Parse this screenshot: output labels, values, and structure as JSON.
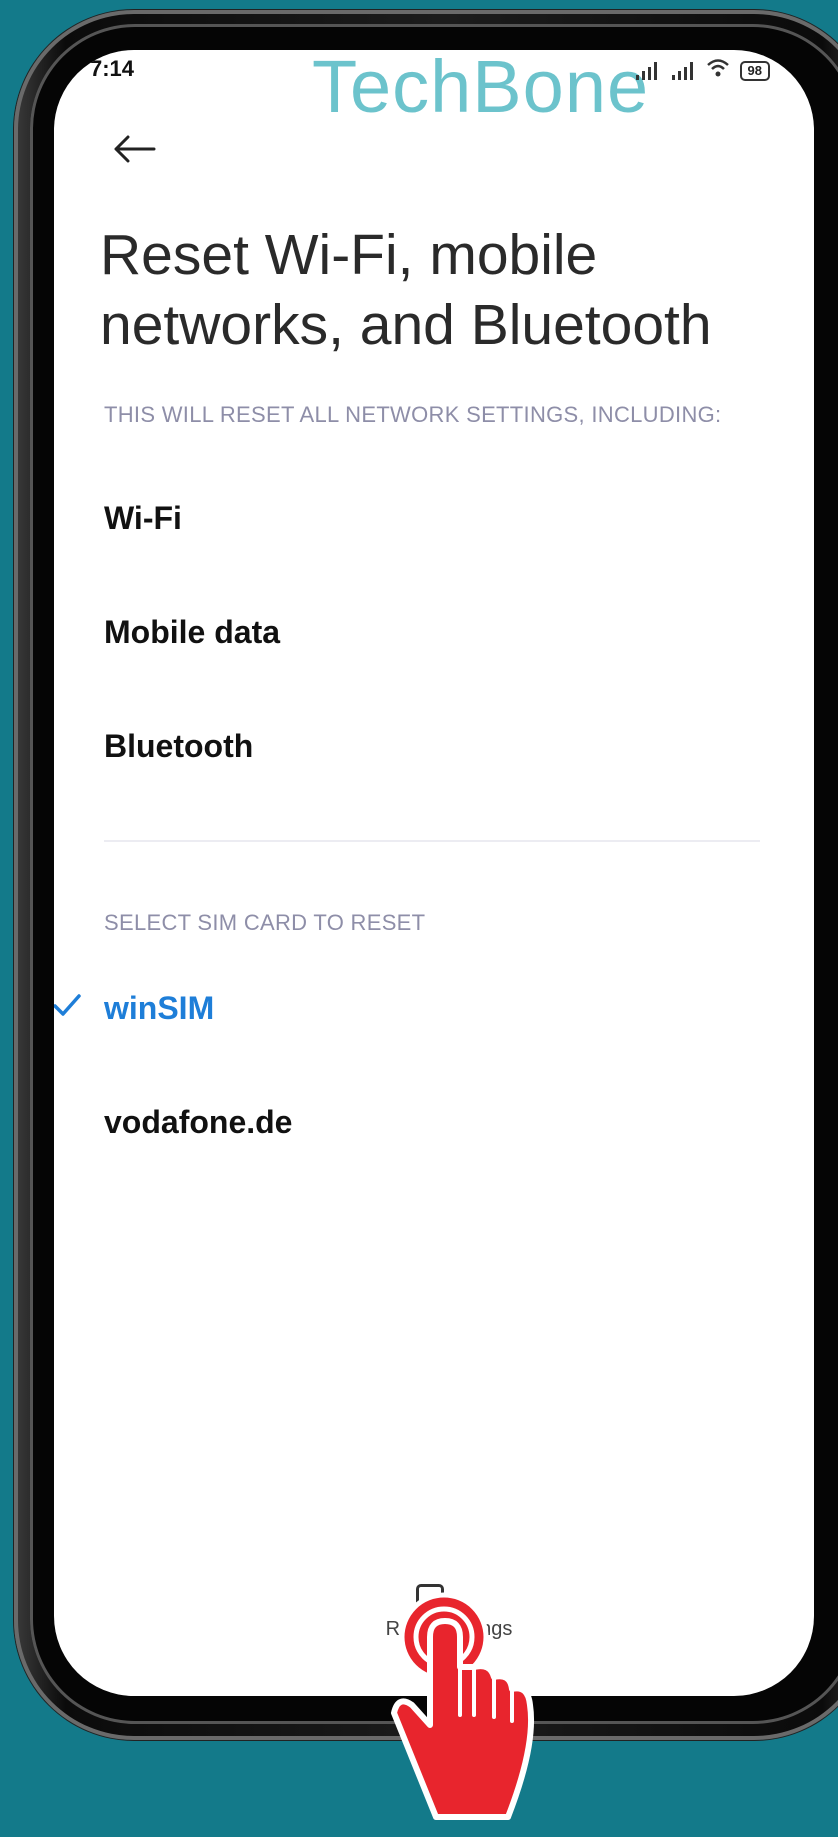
{
  "theme": {
    "background": "#137a8a",
    "accent": "#1e7ed8",
    "watermark": "#6cc3cc",
    "hand": "#e8252d"
  },
  "status_bar": {
    "time": "7:14",
    "battery": "98"
  },
  "watermark": {
    "text": "TechBone"
  },
  "header": {
    "back_icon": "arrow-left-icon"
  },
  "page": {
    "title_line1": "Reset Wi-Fi, mobile",
    "title_line2": "networks, and Bluetooth",
    "network_section_heading": "THIS WILL RESET ALL NETWORK SETTINGS, INCLUDING:",
    "network_items": [
      "Wi-Fi",
      "Mobile data",
      "Bluetooth"
    ],
    "sim_section_heading": "SELECT SIM CARD TO RESET",
    "sim_options": [
      {
        "label": "winSIM",
        "selected": true
      },
      {
        "label": "vodafone.de",
        "selected": false
      }
    ]
  },
  "footer": {
    "reset_button_label": "Reset settings",
    "reset_icon": "reset-settings-icon",
    "pointer_icon": "tap-hand-icon"
  }
}
